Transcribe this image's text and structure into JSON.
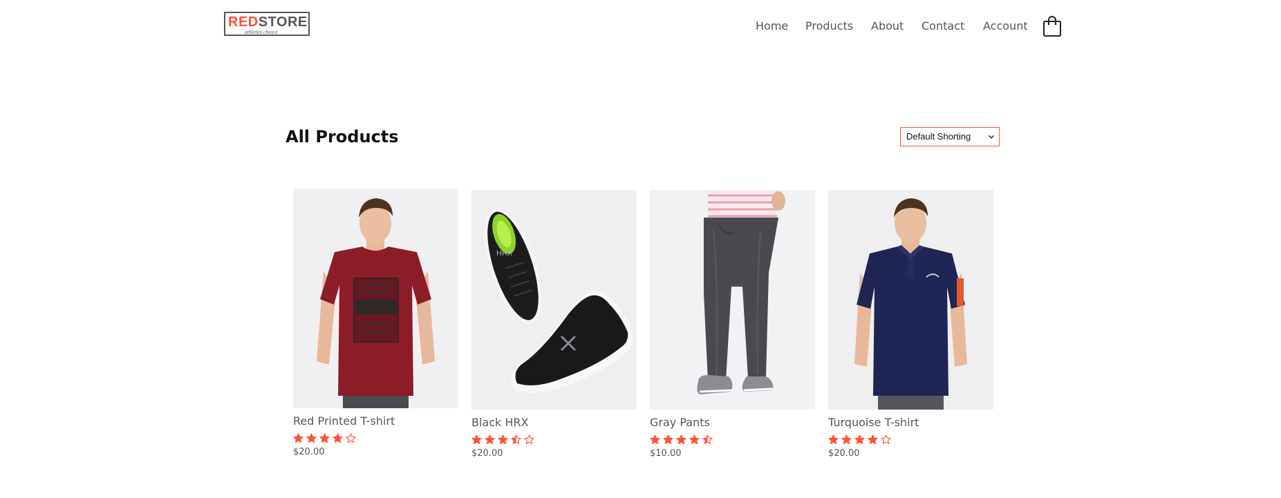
{
  "brand": {
    "logo_red": "RED",
    "logo_dark": "STORE",
    "tagline": "athletes choice",
    "accent_color": "#ff523b"
  },
  "nav": {
    "items": [
      {
        "label": "Home"
      },
      {
        "label": "Products"
      },
      {
        "label": "About"
      },
      {
        "label": "Contact"
      },
      {
        "label": "Account"
      }
    ],
    "cart_icon": "shopping-bag-icon"
  },
  "page": {
    "title": "All Products",
    "sort": {
      "selected": "Default Shorting"
    }
  },
  "products": [
    {
      "name": "Red Printed T-shirt",
      "rating": 4,
      "rating_max": 5,
      "price": "$20.00",
      "image": "model-red-tshirt"
    },
    {
      "name": "Black HRX",
      "rating": 3.5,
      "rating_max": 5,
      "price": "$20.00",
      "image": "black-hrx-shoes",
      "image_text": "HRX"
    },
    {
      "name": "Gray Pants",
      "rating": 4.5,
      "rating_max": 5,
      "price": "$10.00",
      "image": "gray-jogger-pants"
    },
    {
      "name": "Turquoise T-shirt",
      "rating": 4,
      "rating_max": 5,
      "price": "$20.00",
      "image": "model-navy-polo"
    }
  ]
}
